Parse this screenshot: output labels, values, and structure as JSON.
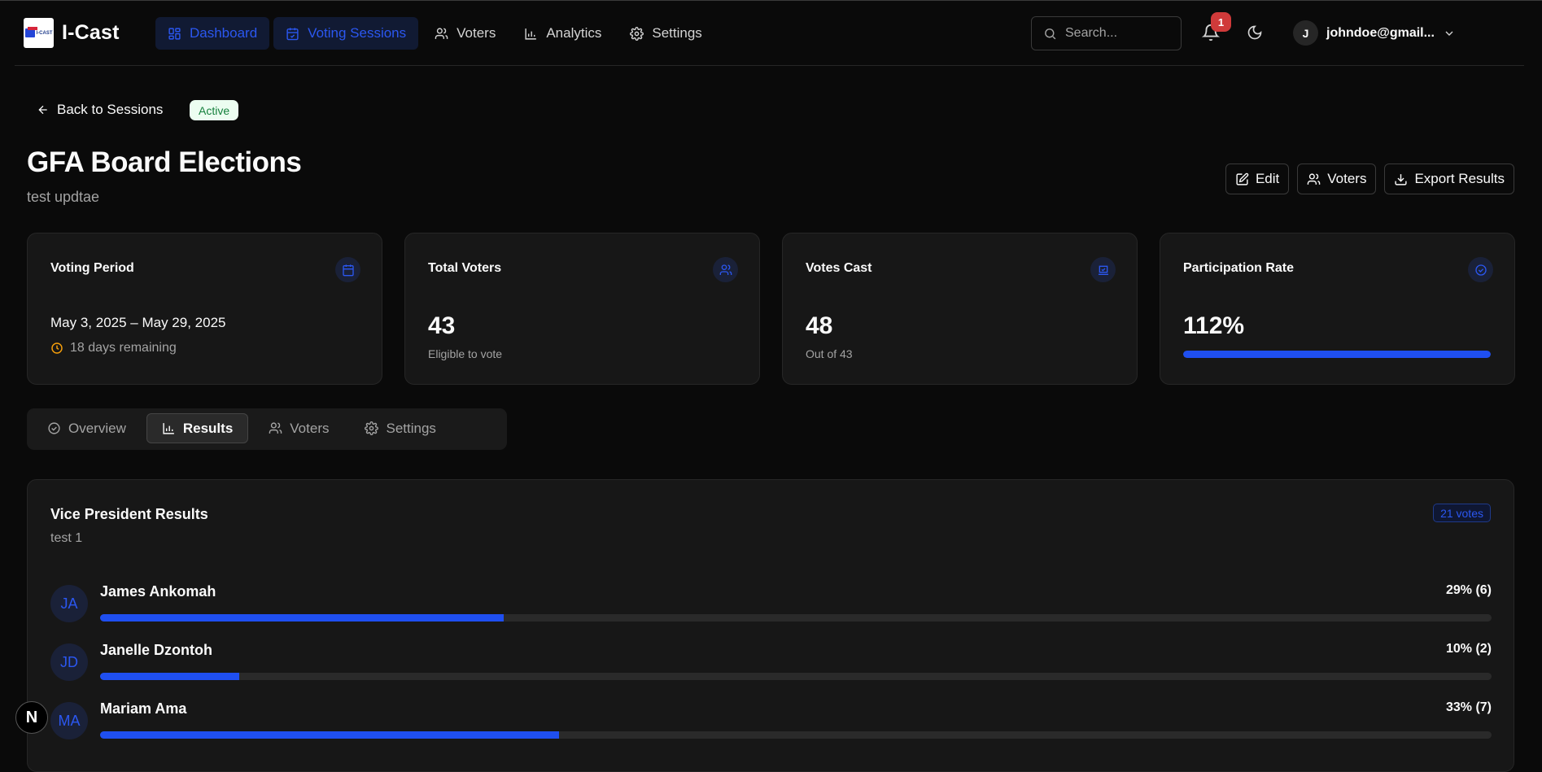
{
  "app": {
    "name": "I-Cast",
    "logo_text": "I-CAST"
  },
  "nav": {
    "items": [
      {
        "label": "Dashboard",
        "icon": "dashboard-icon"
      },
      {
        "label": "Voting Sessions",
        "icon": "calendar-icon"
      },
      {
        "label": "Voters",
        "icon": "users-icon"
      },
      {
        "label": "Analytics",
        "icon": "bar-chart-icon"
      },
      {
        "label": "Settings",
        "icon": "gear-icon"
      }
    ]
  },
  "header": {
    "search_placeholder": "Search...",
    "notification_count": "1",
    "user_initial": "J",
    "user_email": "johndoe@gmail..."
  },
  "session": {
    "back_label": "Back to Sessions",
    "status": "Active",
    "title": "GFA Board Elections",
    "description": "test updtae",
    "actions": {
      "edit": "Edit",
      "voters": "Voters",
      "export": "Export Results"
    }
  },
  "stats": {
    "period": {
      "title": "Voting Period",
      "range": "May 3, 2025 – May 29, 2025",
      "remaining": "18 days remaining"
    },
    "total_voters": {
      "title": "Total Voters",
      "value": "43",
      "sub": "Eligible to vote"
    },
    "votes_cast": {
      "title": "Votes Cast",
      "value": "48",
      "sub": "Out of 43"
    },
    "participation": {
      "title": "Participation Rate",
      "value": "112%",
      "progress": 1.0
    }
  },
  "tabs": [
    {
      "label": "Overview",
      "icon": "check-circle-icon"
    },
    {
      "label": "Results",
      "icon": "bar-chart-icon"
    },
    {
      "label": "Voters",
      "icon": "users-icon"
    },
    {
      "label": "Settings",
      "icon": "gear-icon"
    }
  ],
  "results": {
    "title": "Vice President Results",
    "subtitle": "test 1",
    "votes_label": "21 votes",
    "candidates": [
      {
        "initials": "JA",
        "name": "James Ankomah",
        "pct_label": "29% (6)",
        "share": 0.29
      },
      {
        "initials": "JD",
        "name": "Janelle Dzontoh",
        "pct_label": "10% (2)",
        "share": 0.1
      },
      {
        "initials": "MA",
        "name": "Mariam Ama",
        "pct_label": "33% (7)",
        "share": 0.33
      }
    ]
  },
  "colors": {
    "accent": "#1f4ff0",
    "accent_text": "#2b57f0",
    "active_pill_bg": "#ecfdf1",
    "active_pill_text": "#15803d",
    "badge": "#d03a3a",
    "warning": "#f59e0b"
  },
  "dev_badge": "N"
}
